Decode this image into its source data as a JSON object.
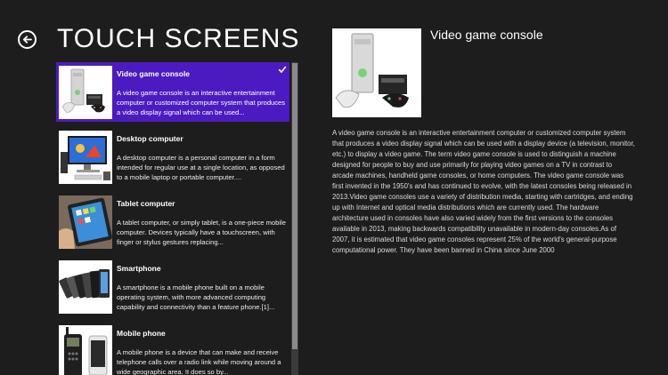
{
  "header": {
    "title": "TOUCH SCREENS",
    "back_icon": "arrow-left-icon"
  },
  "list": {
    "items": [
      {
        "title": "Video game console",
        "description": "A video game console is an interactive entertainment computer or customized computer system that produces a video display signal which can be used...",
        "selected": true,
        "icon": "video-game-console-thumbnail"
      },
      {
        "title": "Desktop computer",
        "description": "A desktop computer is a personal computer in a form intended for regular use at a single location, as opposed to a mobile laptop or portable computer....",
        "selected": false,
        "icon": "desktop-computer-thumbnail"
      },
      {
        "title": "Tablet computer",
        "description": "A tablet computer, or simply tablet, is a one-piece mobile computer. Devices typically have a touchscreen, with finger or stylus gestures replacing...",
        "selected": false,
        "icon": "tablet-computer-thumbnail"
      },
      {
        "title": "Smartphone",
        "description": "A smartphone is a mobile phone built on a mobile operating system, with more advanced computing capability and connectivity than a feature phone.[1]...",
        "selected": false,
        "icon": "smartphone-thumbnail"
      },
      {
        "title": "Mobile phone",
        "description": "A mobile phone  is a device that can make and receive telephone calls over a radio link while moving around a wide geographic area. It does so by...",
        "selected": false,
        "icon": "mobile-phone-thumbnail"
      }
    ]
  },
  "detail": {
    "title": "Video game console",
    "body": "A video game console is an interactive entertainment computer or customized computer system that produces a video display signal which can be used with a display device (a television, monitor, etc.) to display a video game. The term video game console is used to distinguish a machine designed for people to buy and use primarily for playing video games on a TV in contrast to arcade machines, handheld game consoles, or home computers. The video game console was first invented in the 1950's and has continued to evolve, with the latest consoles being released in 2013.Video game consoles use a variety of distribution media, starting with cartridges, and ending up with Internet and optical media distributions which are currently used. The hardware architecture used in consoles have also varied widely from the first versions to the consoles available in 2013, making backwards compatibility unavailable in modern-day consoles.As of 2007, it is estimated that video game consoles represent 25% of the world's general-purpose computational power. They have been banned in China since June 2000",
    "image_icon": "video-game-console-image"
  },
  "colors": {
    "background": "#1d1d1d",
    "selection": "#4b1bc1",
    "scroll_thumb": "#8a8a8a"
  }
}
